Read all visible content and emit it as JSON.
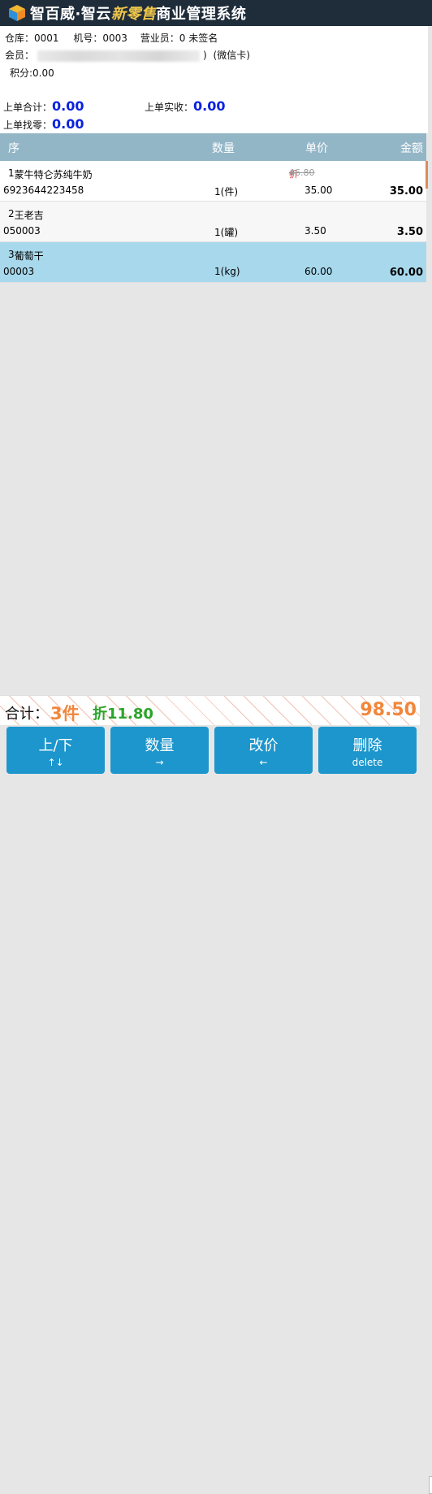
{
  "app": {
    "title_main": "智百威·智云",
    "title_accent": "新零售",
    "title_tail": "商业管理系统"
  },
  "info": {
    "warehouse_label": "仓库：",
    "warehouse": "0001",
    "machine_label": "机号：",
    "machine": "0003",
    "clerk_label": "营业员：",
    "clerk": "0 未签名",
    "member_label": "会员：",
    "member_tail": ")",
    "member_type": "(微信卡)",
    "points_label": "积分:",
    "points": "0.00",
    "last_total_label": "上单合计：",
    "last_total": "0.00",
    "last_paid_label": "上单实收：",
    "last_paid": "0.00",
    "last_change_label": "上单找零：",
    "last_change": "0.00"
  },
  "table": {
    "columns": [
      "序",
      "数量",
      "单价",
      "金额"
    ],
    "rows": [
      {
        "index": "1",
        "name": "蒙牛特仑苏纯牛奶",
        "code": "6923644223458",
        "qty": "1(件)",
        "price": "35.00",
        "amount": "35.00",
        "discount_mark": "折",
        "original_price": "46.80"
      },
      {
        "index": "2",
        "name": "王老吉",
        "code": "050003",
        "qty": "1(罐)",
        "price": "3.50",
        "amount": "3.50"
      },
      {
        "index": "3",
        "name": "葡萄干",
        "code": "00003",
        "qty": "1(kg)",
        "price": "60.00",
        "amount": "60.00"
      }
    ]
  },
  "summary": {
    "label": "合计：",
    "count": "3件",
    "discount": "折11.80",
    "total": "98.50"
  },
  "buttons": [
    {
      "label": "上/下",
      "key": "↑↓"
    },
    {
      "label": "数量",
      "key": "→"
    },
    {
      "label": "改价",
      "key": "←"
    },
    {
      "label": "删除",
      "key": "delete"
    }
  ],
  "colors": {
    "titlebar": "#1f2d3a",
    "header": "#93b6c7",
    "selected_row": "#a8d8ec",
    "value_blue": "#0a22e0",
    "accent_orange": "#f2863a",
    "discount_green": "#2aa52a",
    "button_blue": "#1c96cc"
  },
  "icons": {
    "logo": "cube-logo-icon"
  }
}
